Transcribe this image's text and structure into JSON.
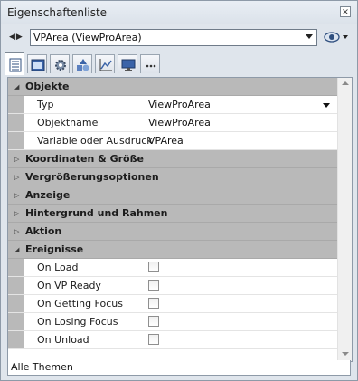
{
  "window": {
    "title": "Eigenschaftenliste",
    "close_glyph": "×"
  },
  "selector": {
    "nav_glyph": "◀▶",
    "selected": "VPArea (ViewProArea)"
  },
  "toolbar": {
    "tabs": [
      {
        "icon": "property-list-icon",
        "active": true
      },
      {
        "icon": "form-icon",
        "active": false
      },
      {
        "icon": "gear-icon",
        "active": false
      },
      {
        "icon": "shapes-icon",
        "active": false
      },
      {
        "icon": "chart-icon",
        "active": false
      },
      {
        "icon": "monitor-icon",
        "active": false
      },
      {
        "icon": "more-icon",
        "active": false
      }
    ]
  },
  "sections": [
    {
      "label": "Objekte",
      "expanded": true,
      "props": [
        {
          "name": "Typ",
          "value": "ViewProArea",
          "dropdown": true
        },
        {
          "name": "Objektname",
          "value": "ViewProArea"
        },
        {
          "name": "Variable oder Ausdruck",
          "value": "VPArea"
        }
      ]
    },
    {
      "label": "Koordinaten & Größe",
      "expanded": false
    },
    {
      "label": "Vergrößerungsoptionen",
      "expanded": false
    },
    {
      "label": "Anzeige",
      "expanded": false
    },
    {
      "label": "Hintergrund und Rahmen",
      "expanded": false
    },
    {
      "label": "Aktion",
      "expanded": false
    },
    {
      "label": "Ereignisse",
      "expanded": true,
      "events": [
        {
          "name": "On Load",
          "checked": false
        },
        {
          "name": "On VP Ready",
          "checked": false
        },
        {
          "name": "On Getting Focus",
          "checked": false
        },
        {
          "name": "On Losing Focus",
          "checked": false
        },
        {
          "name": "On Unload",
          "checked": false
        }
      ]
    }
  ],
  "status": {
    "theme_filter": "Alle Themen"
  },
  "colors": {
    "category_bg": "#b9b9b9",
    "window_bg": "#dfe5ec"
  }
}
